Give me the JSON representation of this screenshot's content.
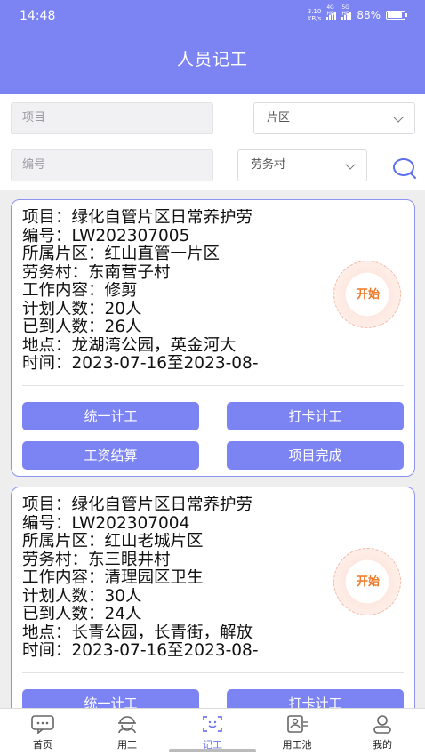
{
  "status": {
    "time": "14:48",
    "speed_top": "3.10",
    "speed_unit": "KB/s",
    "net1": "4G HD",
    "net2": "5G HD",
    "battery": "88%",
    "battery_level": 0.88
  },
  "header": {
    "title": "人员记工"
  },
  "filters": {
    "project_placeholder": "项目",
    "district_select": "片区",
    "code_placeholder": "编号",
    "village_select": "劳务村"
  },
  "labels": {
    "project": "项目：",
    "code": "编号：",
    "district": "所属片区：",
    "village": "劳务村：",
    "content": "工作内容：",
    "planned": "计划人数：",
    "arrived": "已到人数：",
    "place": "地点：",
    "time": "时间："
  },
  "cards": [
    {
      "project": "绿化自管片区日常养护劳",
      "code": "LW202307005",
      "district": "红山直管一片区",
      "village": "东南营子村",
      "content": "修剪",
      "planned": "20人",
      "arrived": "26人",
      "place": "龙湖湾公园，英金河大",
      "time": "2023-07-16至2023-08-",
      "badge": "开始",
      "buttons": [
        "统一计工",
        "打卡计工",
        "工资结算",
        "项目完成"
      ]
    },
    {
      "project": "绿化自管片区日常养护劳",
      "code": "LW202307004",
      "district": "红山老城片区",
      "village": "东三眼井村",
      "content": "清理园区卫生",
      "planned": "30人",
      "arrived": "24人",
      "place": "长青公园，长青街，解放",
      "time": "2023-07-16至2023-08-",
      "badge": "开始",
      "buttons": [
        "统一计工",
        "打卡计工"
      ]
    }
  ],
  "tabbar": {
    "items": [
      {
        "label": "首页",
        "icon": "home-chat-icon"
      },
      {
        "label": "用工",
        "icon": "worker-helmet-icon"
      },
      {
        "label": "记工",
        "icon": "scan-face-icon"
      },
      {
        "label": "用工池",
        "icon": "people-list-icon"
      },
      {
        "label": "我的",
        "icon": "user-icon"
      }
    ],
    "active": "记工"
  },
  "colors": {
    "accent": "#7c83f3",
    "badge_text": "#ee7a2a",
    "card_border": "#8d93f0"
  }
}
